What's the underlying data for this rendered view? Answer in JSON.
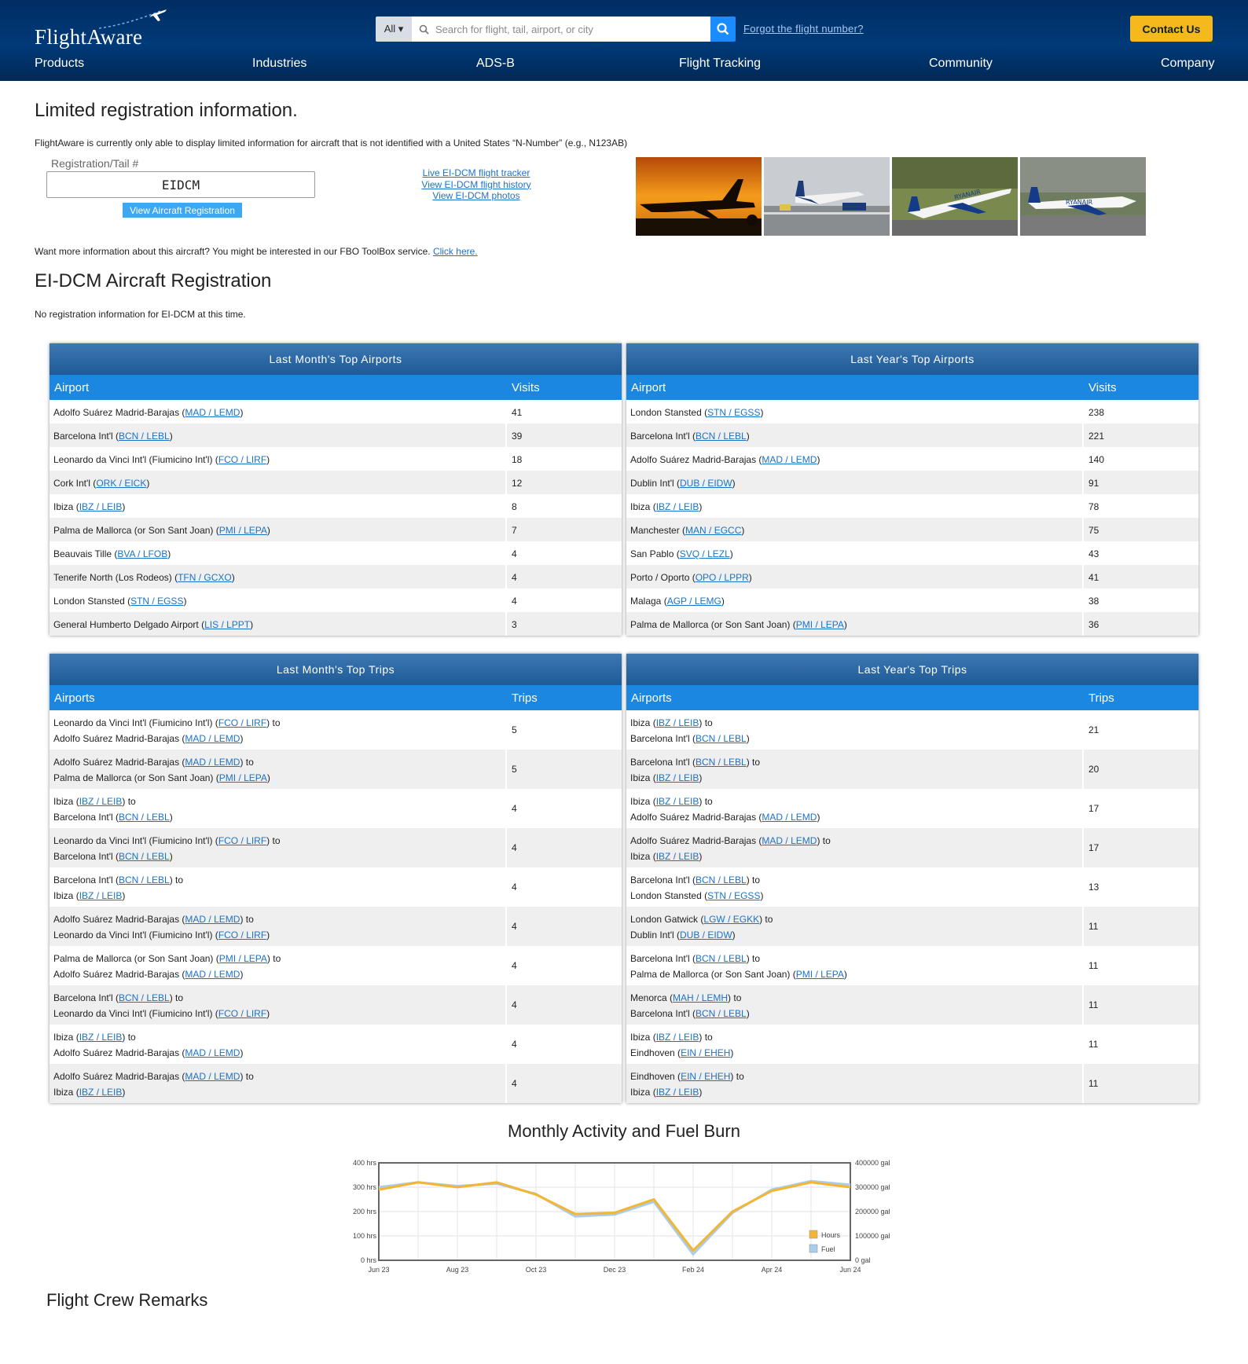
{
  "header": {
    "logo_text": "FlightAware",
    "search_scope": "All ▾",
    "search_placeholder": "Search for flight, tail, airport, or city",
    "forgot_link": "Forgot the flight number?",
    "contact_button": "Contact Us",
    "nav": [
      "Products",
      "Industries",
      "ADS-B",
      "Flight Tracking",
      "Community",
      "Company"
    ]
  },
  "intro": {
    "title": "Limited registration information.",
    "notice": "FlightAware is currently only able to display limited information for aircraft that is not identified with a United States “N-Number” (e.g., N123AB)",
    "reg_label": "Registration/Tail #",
    "reg_value": "EIDCM",
    "reg_button": "View Aircraft Registration",
    "links": [
      "Live EI-DCM flight tracker",
      "View EI-DCM flight history",
      "View EI-DCM photos"
    ],
    "fbo_text": "Want more information about this aircraft? You might be interested in our FBO ToolBox service.",
    "fbo_link": "Click here."
  },
  "registration": {
    "title": "EI-DCM Aircraft Registration",
    "note": "No registration information for EI-DCM at this time."
  },
  "tables": {
    "last_month_airports": {
      "title": "Last Month's Top Airports",
      "col1": "Airport",
      "col2": "Visits",
      "rows": [
        {
          "name": "Adolfo Suárez Madrid-Barajas",
          "code": "MAD / LEMD",
          "value": "41"
        },
        {
          "name": "Barcelona Int'l",
          "code": "BCN / LEBL",
          "value": "39"
        },
        {
          "name": "Leonardo da Vinci Int'l (Fiumicino Int'l)",
          "code": "FCO / LIRF",
          "value": "18"
        },
        {
          "name": "Cork Int'l",
          "code": "ORK / EICK",
          "value": "12"
        },
        {
          "name": "Ibiza",
          "code": "IBZ / LEIB",
          "value": "8"
        },
        {
          "name": "Palma de Mallorca (or Son Sant Joan)",
          "code": "PMI / LEPA",
          "value": "7"
        },
        {
          "name": "Beauvais Tille",
          "code": "BVA / LFOB",
          "value": "4"
        },
        {
          "name": "Tenerife North (Los Rodeos)",
          "code": "TFN / GCXO",
          "value": "4"
        },
        {
          "name": "London Stansted",
          "code": "STN / EGSS",
          "value": "4"
        },
        {
          "name": "General Humberto Delgado Airport",
          "code": "LIS / LPPT",
          "value": "3"
        }
      ]
    },
    "last_year_airports": {
      "title": "Last Year's Top Airports",
      "col1": "Airport",
      "col2": "Visits",
      "rows": [
        {
          "name": "London Stansted",
          "code": "STN / EGSS",
          "value": "238"
        },
        {
          "name": "Barcelona Int'l",
          "code": "BCN / LEBL",
          "value": "221"
        },
        {
          "name": "Adolfo Suárez Madrid-Barajas",
          "code": "MAD / LEMD",
          "value": "140"
        },
        {
          "name": "Dublin Int'l",
          "code": "DUB / EIDW",
          "value": "91"
        },
        {
          "name": "Ibiza",
          "code": "IBZ / LEIB",
          "value": "78"
        },
        {
          "name": "Manchester",
          "code": "MAN / EGCC",
          "value": "75"
        },
        {
          "name": "San Pablo",
          "code": "SVQ / LEZL",
          "value": "43"
        },
        {
          "name": "Porto / Oporto",
          "code": "OPO / LPPR",
          "value": "41"
        },
        {
          "name": "Malaga",
          "code": "AGP / LEMG",
          "value": "38"
        },
        {
          "name": "Palma de Mallorca (or Son Sant Joan)",
          "code": "PMI / LEPA",
          "value": "36"
        }
      ]
    },
    "last_month_trips": {
      "title": "Last Month's Top Trips",
      "col1": "Airports",
      "col2": "Trips",
      "rows": [
        {
          "from": "Leonardo da Vinci Int'l (Fiumicino Int'l)",
          "from_code": "FCO / LIRF",
          "to": "Adolfo Suárez Madrid-Barajas",
          "to_code": "MAD / LEMD",
          "value": "5"
        },
        {
          "from": "Adolfo Suárez Madrid-Barajas",
          "from_code": "MAD / LEMD",
          "to": "Palma de Mallorca (or Son Sant Joan)",
          "to_code": "PMI / LEPA",
          "value": "5"
        },
        {
          "from": "Ibiza",
          "from_code": "IBZ / LEIB",
          "to": "Barcelona Int'l",
          "to_code": "BCN / LEBL",
          "value": "4"
        },
        {
          "from": "Leonardo da Vinci Int'l (Fiumicino Int'l)",
          "from_code": "FCO / LIRF",
          "to": "Barcelona Int'l",
          "to_code": "BCN / LEBL",
          "value": "4"
        },
        {
          "from": "Barcelona Int'l",
          "from_code": "BCN / LEBL",
          "to": "Ibiza",
          "to_code": "IBZ / LEIB",
          "value": "4"
        },
        {
          "from": "Adolfo Suárez Madrid-Barajas",
          "from_code": "MAD / LEMD",
          "to": "Leonardo da Vinci Int'l (Fiumicino Int'l)",
          "to_code": "FCO / LIRF",
          "value": "4"
        },
        {
          "from": "Palma de Mallorca (or Son Sant Joan)",
          "from_code": "PMI / LEPA",
          "to": "Adolfo Suárez Madrid-Barajas",
          "to_code": "MAD / LEMD",
          "value": "4"
        },
        {
          "from": "Barcelona Int'l",
          "from_code": "BCN / LEBL",
          "to": "Leonardo da Vinci Int'l (Fiumicino Int'l)",
          "to_code": "FCO / LIRF",
          "value": "4"
        },
        {
          "from": "Ibiza",
          "from_code": "IBZ / LEIB",
          "to": "Adolfo Suárez Madrid-Barajas",
          "to_code": "MAD / LEMD",
          "value": "4"
        },
        {
          "from": "Adolfo Suárez Madrid-Barajas",
          "from_code": "MAD / LEMD",
          "to": "Ibiza",
          "to_code": "IBZ / LEIB",
          "value": "4"
        }
      ]
    },
    "last_year_trips": {
      "title": "Last Year's Top Trips",
      "col1": "Airports",
      "col2": "Trips",
      "rows": [
        {
          "from": "Ibiza",
          "from_code": "IBZ / LEIB",
          "to": "Barcelona Int'l",
          "to_code": "BCN / LEBL",
          "value": "21"
        },
        {
          "from": "Barcelona Int'l",
          "from_code": "BCN / LEBL",
          "to": "Ibiza",
          "to_code": "IBZ / LEIB",
          "value": "20"
        },
        {
          "from": "Ibiza",
          "from_code": "IBZ / LEIB",
          "to": "Adolfo Suárez Madrid-Barajas",
          "to_code": "MAD / LEMD",
          "value": "17"
        },
        {
          "from": "Adolfo Suárez Madrid-Barajas",
          "from_code": "MAD / LEMD",
          "to": "Ibiza",
          "to_code": "IBZ / LEIB",
          "value": "17"
        },
        {
          "from": "Barcelona Int'l",
          "from_code": "BCN / LEBL",
          "to": "London Stansted",
          "to_code": "STN / EGSS",
          "value": "13"
        },
        {
          "from": "London Gatwick",
          "from_code": "LGW / EGKK",
          "to": "Dublin Int'l",
          "to_code": "DUB / EIDW",
          "value": "11"
        },
        {
          "from": "Barcelona Int'l",
          "from_code": "BCN / LEBL",
          "to": "Palma de Mallorca (or Son Sant Joan)",
          "to_code": "PMI / LEPA",
          "value": "11"
        },
        {
          "from": "Menorca",
          "from_code": "MAH / LEMH",
          "to": "Barcelona Int'l",
          "to_code": "BCN / LEBL",
          "value": "11"
        },
        {
          "from": "Ibiza",
          "from_code": "IBZ / LEIB",
          "to": "Eindhoven",
          "to_code": "EIN / EHEH",
          "value": "11"
        },
        {
          "from": "Eindhoven",
          "from_code": "EIN / EHEH",
          "to": "Ibiza",
          "to_code": "IBZ / LEIB",
          "value": "11"
        }
      ]
    }
  },
  "chart_data": {
    "type": "line",
    "title": "Monthly Activity and Fuel Burn",
    "categories": [
      "Jun 23",
      "Jul 23",
      "Aug 23",
      "Sep 23",
      "Oct 23",
      "Nov 23",
      "Dec 23",
      "Jan 24",
      "Feb 24",
      "Mar 24",
      "Apr 24",
      "May 24",
      "Jun 24"
    ],
    "x_tick_labels": [
      "Jun 23",
      "Aug 23",
      "Oct 23",
      "Dec 23",
      "Feb 24",
      "Apr 24",
      "Jun 24"
    ],
    "y_left_ticks": [
      "400 hrs",
      "300 hrs",
      "200 hrs",
      "100 hrs",
      "0 hrs"
    ],
    "y_right_ticks": [
      "400000 gal",
      "300000 gal",
      "200000 gal",
      "100000 gal",
      "0 gal"
    ],
    "ylim_left": [
      0,
      400
    ],
    "ylim_right": [
      0,
      400000
    ],
    "grid": true,
    "legend_position": "bottom-right",
    "series": [
      {
        "name": "Hours",
        "axis": "left",
        "color": "#f2b632",
        "values": [
          290,
          320,
          300,
          320,
          270,
          190,
          195,
          250,
          40,
          200,
          285,
          320,
          300
        ]
      },
      {
        "name": "Fuel",
        "axis": "right",
        "color": "#a9cdea",
        "values": [
          300000,
          320000,
          305000,
          315000,
          272000,
          180000,
          188000,
          240000,
          25000,
          195000,
          290000,
          325000,
          310000
        ]
      }
    ]
  },
  "remarks": {
    "title": "Flight Crew Remarks"
  },
  "colors": {
    "header_bg": "#003a78",
    "accent_blue": "#1b87e0",
    "contact_yellow": "#f5b91e",
    "search_button": "#1a8cff",
    "link": "#1a73c8"
  }
}
